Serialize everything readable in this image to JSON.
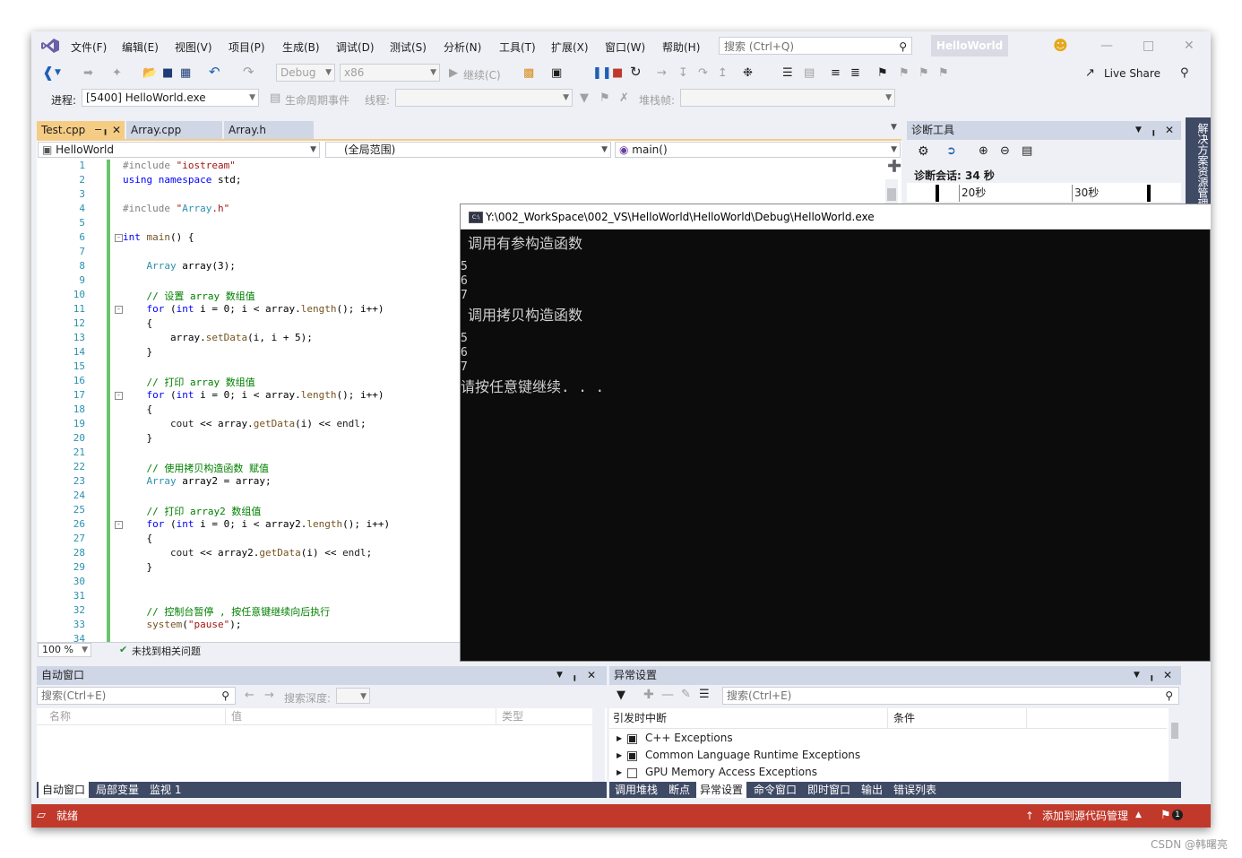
{
  "menu": {
    "items": [
      "文件(F)",
      "编辑(E)",
      "视图(V)",
      "项目(P)",
      "生成(B)",
      "调试(D)",
      "测试(S)",
      "分析(N)",
      "工具(T)",
      "扩展(X)",
      "窗口(W)",
      "帮助(H)"
    ],
    "search_placeholder": "搜索 (Ctrl+Q)",
    "solution_name": "HelloWorld"
  },
  "toolbar": {
    "config": "Debug",
    "platform": "x86",
    "continue_label": "继续(C)",
    "live_share": "Live Share",
    "process_label": "进程:",
    "process_value": "[5400] HelloWorld.exe",
    "lifecycle_label": "生命周期事件",
    "thread_label": "线程:",
    "stackframe_label": "堆栈帧:"
  },
  "editor": {
    "tabs": [
      {
        "label": "Test.cpp",
        "active": true
      },
      {
        "label": "Array.cpp",
        "active": false
      },
      {
        "label": "Array.h",
        "active": false
      }
    ],
    "nav": {
      "project": "HelloWorld",
      "scope": "(全局范围)",
      "member": "main()"
    },
    "zoom": "100 %",
    "issues": "未找到相关问题",
    "lines": [
      {
        "n": "1",
        "text": "#include \"iostream\""
      },
      {
        "n": "2",
        "text": "using namespace std;"
      },
      {
        "n": "3",
        "text": ""
      },
      {
        "n": "4",
        "text": "#include \"Array.h\""
      },
      {
        "n": "5",
        "text": ""
      },
      {
        "n": "6",
        "text": "int main() {"
      },
      {
        "n": "7",
        "text": ""
      },
      {
        "n": "8",
        "text": "    Array array(3);"
      },
      {
        "n": "9",
        "text": ""
      },
      {
        "n": "10",
        "text": "    // 设置 array 数组值"
      },
      {
        "n": "11",
        "text": "    for (int i = 0; i < array.length(); i++)"
      },
      {
        "n": "12",
        "text": "    {"
      },
      {
        "n": "13",
        "text": "        array.setData(i, i + 5);"
      },
      {
        "n": "14",
        "text": "    }"
      },
      {
        "n": "15",
        "text": ""
      },
      {
        "n": "16",
        "text": "    // 打印 array 数组值"
      },
      {
        "n": "17",
        "text": "    for (int i = 0; i < array.length(); i++)"
      },
      {
        "n": "18",
        "text": "    {"
      },
      {
        "n": "19",
        "text": "        cout << array.getData(i) << endl;"
      },
      {
        "n": "20",
        "text": "    }"
      },
      {
        "n": "21",
        "text": ""
      },
      {
        "n": "22",
        "text": "    // 使用拷贝构造函数 赋值"
      },
      {
        "n": "23",
        "text": "    Array array2 = array;"
      },
      {
        "n": "24",
        "text": ""
      },
      {
        "n": "25",
        "text": "    // 打印 array2 数组值"
      },
      {
        "n": "26",
        "text": "    for (int i = 0; i < array2.length(); i++)"
      },
      {
        "n": "27",
        "text": "    {"
      },
      {
        "n": "28",
        "text": "        cout << array2.getData(i) << endl;"
      },
      {
        "n": "29",
        "text": "    }"
      },
      {
        "n": "30",
        "text": ""
      },
      {
        "n": "31",
        "text": ""
      },
      {
        "n": "32",
        "text": "    // 控制台暂停 , 按任意键继续向后执行"
      },
      {
        "n": "33",
        "text": "    system(\"pause\");"
      },
      {
        "n": "34",
        "text": ""
      }
    ]
  },
  "diagnostics": {
    "title": "诊断工具",
    "session": "诊断会话: 34 秒",
    "tick1": "20秒",
    "tick2": "30秒",
    "solution_explorer": "解决方案资源管理器"
  },
  "console": {
    "title": "Y:\\002_WorkSpace\\002_VS\\HelloWorld\\HelloWorld\\Debug\\HelloWorld.exe",
    "lines": [
      "调用有参构造函数",
      "5",
      "6",
      "7",
      "调用拷贝构造函数",
      "5",
      "6",
      "7",
      "请按任意键继续. . ."
    ]
  },
  "autos": {
    "title": "自动窗口",
    "search_placeholder": "搜索(Ctrl+E)",
    "depth_label": "搜索深度:",
    "col_name": "名称",
    "col_value": "值",
    "col_type": "类型",
    "tabs": [
      "自动窗口",
      "局部变量",
      "监视 1"
    ]
  },
  "exceptions": {
    "title": "异常设置",
    "search_placeholder": "搜索(Ctrl+E)",
    "col_break": "引发时中断",
    "col_condition": "条件",
    "rows": [
      "C++ Exceptions",
      "Common Language Runtime Exceptions",
      "GPU Memory Access Exceptions"
    ],
    "tabs": [
      "调用堆栈",
      "断点",
      "异常设置",
      "命令窗口",
      "即时窗口",
      "输出",
      "错误列表"
    ]
  },
  "status": {
    "ready": "就绪",
    "source_control": "添加到源代码管理",
    "notifications": "1"
  },
  "watermark": "CSDN @韩曙亮",
  "colors": {
    "status_bar": "#c1392b",
    "active_tab": "#f5cc84",
    "console_bg": "#0c0c0c",
    "keyword": "#0000ff",
    "comment": "#008000",
    "string": "#a31515"
  }
}
